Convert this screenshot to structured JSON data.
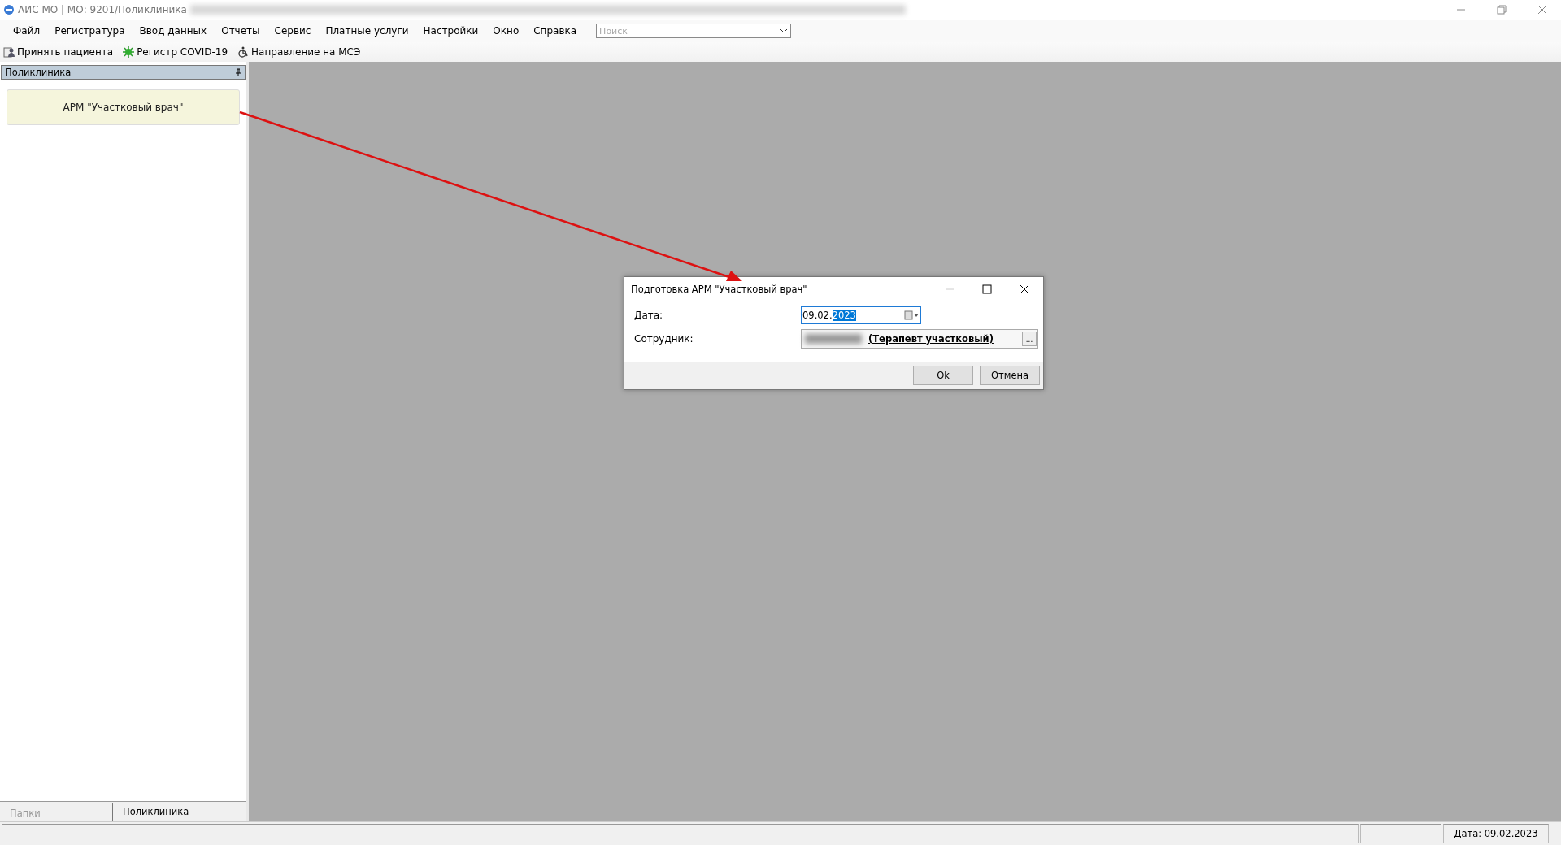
{
  "window": {
    "title": "АИС МО | МО: 9201/Поликлиника"
  },
  "menu": [
    {
      "label": "Файл"
    },
    {
      "label": "Регистратура"
    },
    {
      "label": "Ввод данных"
    },
    {
      "label": "Отчеты"
    },
    {
      "label": "Сервис"
    },
    {
      "label": "Платные услуги"
    },
    {
      "label": "Настройки"
    },
    {
      "label": "Окно"
    },
    {
      "label": "Справка"
    }
  ],
  "search": {
    "placeholder": "Поиск"
  },
  "toolbar": [
    {
      "kind": "patient",
      "label": "Принять пациента"
    },
    {
      "kind": "virus",
      "label": "Регистр COVID-19"
    },
    {
      "kind": "referral",
      "label": "Направление на МСЭ"
    }
  ],
  "sidebar": {
    "title": "Поликлиника",
    "items": [
      {
        "label": "АРМ \"Участковый врач\""
      }
    ],
    "tabs": [
      {
        "label": "Папки",
        "selected": false
      },
      {
        "label": "Поликлиника",
        "selected": true
      }
    ]
  },
  "dialog": {
    "title": "Подготовка АРМ \"Участковый врач\"",
    "date_label": "Дата:",
    "date_value": "09.02.",
    "date_selected": "2023",
    "employee_label": "Сотрудник:",
    "employee_role": "(Терапевт участковый)",
    "browse": "...",
    "buttons": [
      "Ok",
      "Отмена"
    ]
  },
  "status_bar": {
    "date": "Дата: 09.02.2023"
  }
}
